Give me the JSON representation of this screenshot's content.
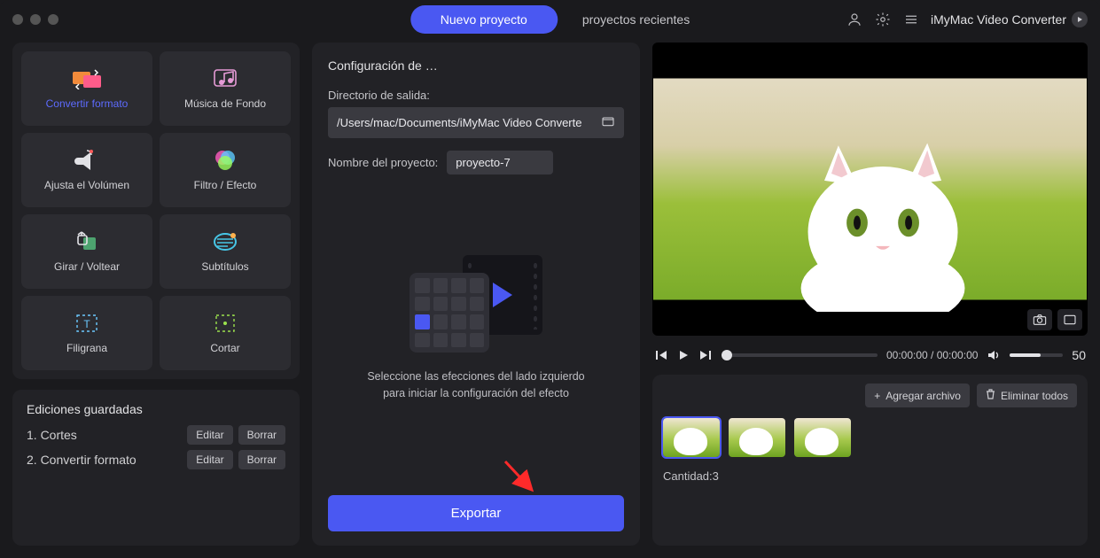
{
  "header": {
    "tab_new": "Nuevo proyecto",
    "tab_recent": "proyectos recientes",
    "brand": "iMyMac Video Converter"
  },
  "tools": [
    {
      "id": "convert-format",
      "label": "Convertir formato",
      "selected": true
    },
    {
      "id": "background-music",
      "label": "Música de Fondo",
      "selected": false
    },
    {
      "id": "adjust-volume",
      "label": "Ajusta el Volúmen",
      "selected": false
    },
    {
      "id": "filter-effect",
      "label": "Filtro / Efecto",
      "selected": false
    },
    {
      "id": "rotate-flip",
      "label": "Girar / Voltear",
      "selected": false
    },
    {
      "id": "subtitles",
      "label": "Subtítulos",
      "selected": false
    },
    {
      "id": "watermark",
      "label": "Filigrana",
      "selected": false
    },
    {
      "id": "crop",
      "label": "Cortar",
      "selected": false
    }
  ],
  "saved": {
    "title": "Ediciones guardadas",
    "items": [
      {
        "name": "Cortes"
      },
      {
        "name": "Convertir formato"
      }
    ],
    "edit_label": "Editar",
    "delete_label": "Borrar"
  },
  "config": {
    "title": "Configuración de …",
    "outdir_label": "Directorio de salida:",
    "outdir_value": "/Users/mac/Documents/iMyMac Video Converte",
    "name_label": "Nombre del proyecto:",
    "name_value": "proyecto-7",
    "placeholder_line1": "Seleccione las efecciones del lado izquierdo",
    "placeholder_line2": "para iniciar la configuración del efecto",
    "export_label": "Exportar"
  },
  "player": {
    "current": "00:00:00",
    "total": "00:00:00",
    "volume": "50"
  },
  "files": {
    "add_label": "Agregar archivo",
    "clear_label": "Eliminar todos",
    "count_label": "Cantidad:3",
    "thumb_count": 3
  }
}
